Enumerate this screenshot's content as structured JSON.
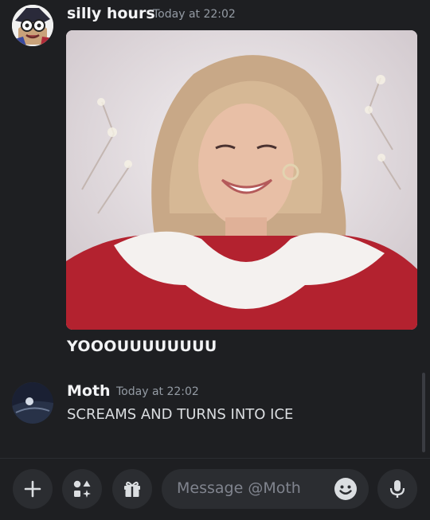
{
  "messages": [
    {
      "author": "silly hours",
      "timestamp": "Today at 22:02",
      "caption": "YOOOUUUUUUUU",
      "attachment_icon": "gif-image"
    },
    {
      "author": "Moth",
      "timestamp": "Today at 22:02",
      "text": "SCREAMS AND TURNS INTO ICE"
    }
  ],
  "composer": {
    "placeholder": "Message @Moth",
    "buttons": [
      "plus-icon",
      "apps-icon",
      "gift-icon",
      "emoji-icon",
      "microphone-icon"
    ]
  },
  "colors": {
    "background": "#1e1f22",
    "input": "#2b2d31",
    "muted": "#949ba4",
    "text": "#dbdee1"
  }
}
